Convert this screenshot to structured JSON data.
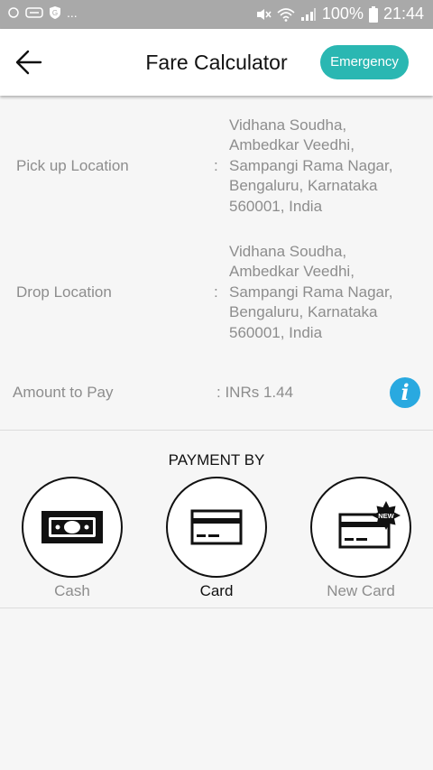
{
  "status_bar": {
    "left_text": "...",
    "battery": "100%",
    "time": "21:44"
  },
  "header": {
    "title": "Fare Calculator",
    "emergency_label": "Emergency"
  },
  "locations": {
    "colon": ":",
    "pickup": {
      "label": "Pick up Location",
      "value": "Vidhana Soudha,\nAmbedkar Veedhi,\nSampangi Rama Nagar,\nBengaluru, Karnataka\n560001, India"
    },
    "drop": {
      "label": "Drop Location",
      "value": "Vidhana Soudha,\nAmbedkar Veedhi,\nSampangi Rama Nagar,\nBengaluru, Karnataka\n560001, India"
    }
  },
  "amount": {
    "label": "Amount to Pay",
    "value": ": INRs  1.44",
    "info_glyph": "i"
  },
  "payment": {
    "title": "PAYMENT BY",
    "options": [
      {
        "label": "Cash",
        "icon": "cash-icon",
        "selected": false
      },
      {
        "label": "Card",
        "icon": "card-icon",
        "selected": true
      },
      {
        "label": "New Card",
        "icon": "new-card-icon",
        "selected": false,
        "badge": "NEW"
      }
    ]
  },
  "colors": {
    "accent": "#2ab7b2",
    "info": "#29a9e0",
    "status_bar": "#a9a9a9",
    "muted_text": "#8d8d8d",
    "selected_text": "#111111"
  }
}
